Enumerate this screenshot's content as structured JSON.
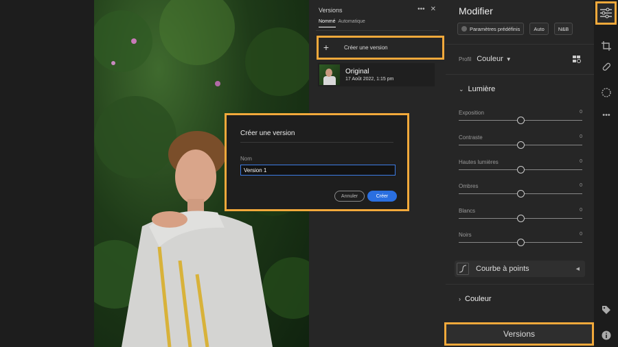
{
  "versions_panel": {
    "title": "Versions",
    "more_icon": "more-icon",
    "close_icon": "close-icon",
    "tabs": [
      {
        "label": "Nommé",
        "active": true
      },
      {
        "label": "Automatique",
        "active": false
      }
    ],
    "create_label": "Créer une version",
    "items": [
      {
        "name": "Original",
        "date": "17 Août 2022, 1:15 pm"
      }
    ]
  },
  "dialog": {
    "title": "Créer une version",
    "field_label": "Nom",
    "field_value": "Version 1",
    "cancel_label": "Annuler",
    "create_label": "Créer"
  },
  "edit_panel": {
    "title": "Modifier",
    "presets": {
      "presets_label": "Paramètres prédéfinis",
      "auto_label": "Auto",
      "bw_label": "N&B"
    },
    "profile": {
      "label": "Profil",
      "value": "Couleur"
    },
    "light_section": {
      "title": "Lumière",
      "sliders": [
        {
          "label": "Exposition",
          "value": "0",
          "level": 0.5
        },
        {
          "label": "Contraste",
          "value": "0",
          "level": 0.5
        },
        {
          "label": "Hautes lumières",
          "value": "0",
          "level": 0.5
        },
        {
          "label": "Ombres",
          "value": "0",
          "level": 0.5
        },
        {
          "label": "Blancs",
          "value": "0",
          "level": 0.5
        },
        {
          "label": "Noirs",
          "value": "0",
          "level": 0.5
        }
      ]
    },
    "curve_label": "Courbe à points",
    "color_section": "Couleur",
    "versions_button": "Versions"
  },
  "toolbar": {
    "icons": [
      "sliders-icon",
      "crop-icon",
      "healing-icon",
      "mask-icon",
      "more-icon",
      "tag-icon",
      "info-icon"
    ]
  },
  "colors": {
    "highlight": "#f2a93b",
    "accent": "#2a6fe0"
  }
}
